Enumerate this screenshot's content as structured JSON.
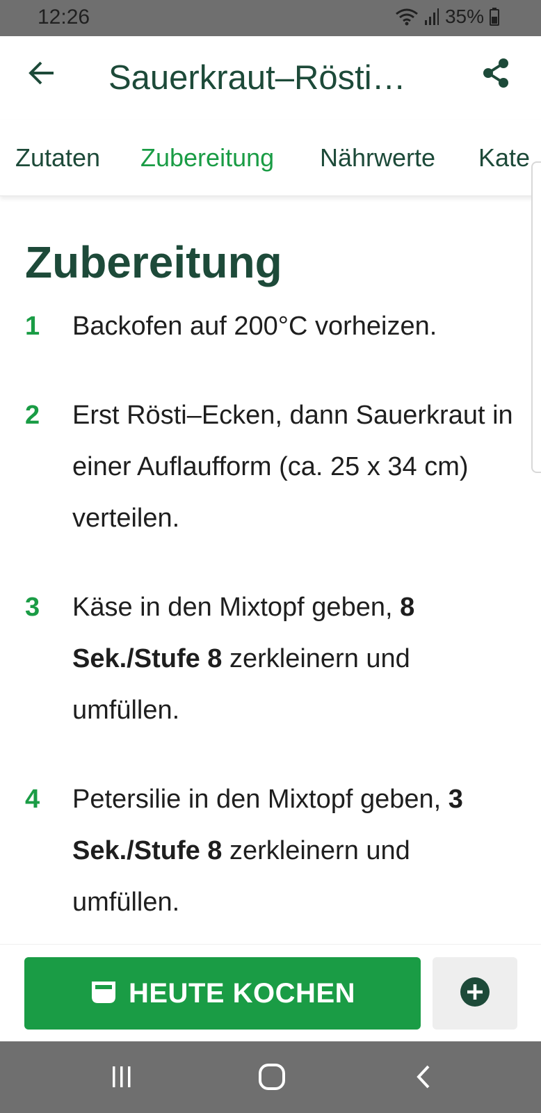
{
  "status_bar": {
    "time": "12:26",
    "battery": "35%",
    "icons": [
      "wifi-icon",
      "signal-icon",
      "battery-icon"
    ]
  },
  "app_bar": {
    "title": "Sauerkraut–Rösti…",
    "back_icon": "arrow-left-icon",
    "share_icon": "share-icon"
  },
  "tabs": [
    {
      "label": "Zutaten",
      "active": false
    },
    {
      "label": "Zubereitung",
      "active": true
    },
    {
      "label": "Nährwerte",
      "active": false
    },
    {
      "label": "Kate",
      "active": false
    }
  ],
  "section": {
    "heading": "Zubereitung"
  },
  "steps": [
    {
      "num": "1",
      "parts": [
        {
          "text": "Backofen auf 200°C vorheizen.",
          "bold": false
        }
      ]
    },
    {
      "num": "2",
      "parts": [
        {
          "text": "Erst Rösti–Ecken, dann Sauerkraut in einer Auflaufform (ca. 25 x 34 cm) verteilen.",
          "bold": false
        }
      ]
    },
    {
      "num": "3",
      "parts": [
        {
          "text": "Käse in den Mixtopf geben, ",
          "bold": false
        },
        {
          "text": "8 Sek./Stufe 8",
          "bold": true
        },
        {
          "text": " zerkleinern und umfüllen.",
          "bold": false
        }
      ]
    },
    {
      "num": "4",
      "parts": [
        {
          "text": "Petersilie in den Mixtopf geben, ",
          "bold": false
        },
        {
          "text": "3 Sek./Stufe 8",
          "bold": true
        },
        {
          "text": " zerkleinern und umfüllen.",
          "bold": false
        }
      ]
    }
  ],
  "actions": {
    "cook_label": "HEUTE KOCHEN",
    "cook_icon": "cooking-pot-icon",
    "add_icon": "plus-circle-icon"
  },
  "colors": {
    "accent_green": "#1a9c45",
    "dark_green": "#1d4a39",
    "system_bar": "#6f6f6f"
  }
}
